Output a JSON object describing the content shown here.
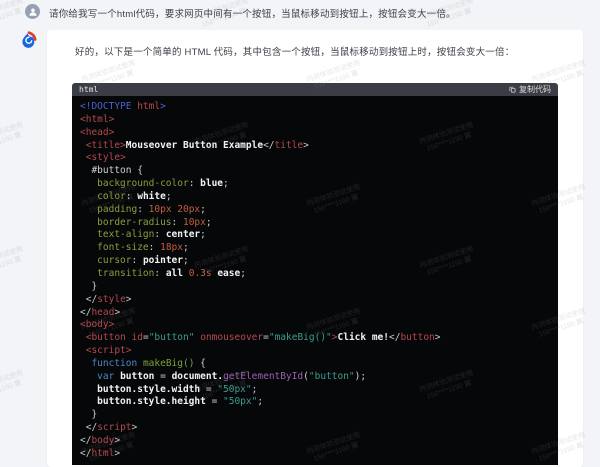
{
  "user_message": {
    "text": "请你给我写一个html代码，要求网页中间有一个按钮，当鼠标移动到按钮上，按钮会变大一倍。"
  },
  "assistant": {
    "intro": "好的，以下是一个简单的 HTML 代码，其中包含一个按钮，当鼠标移动到按钮上时，按钮会变大一倍："
  },
  "watermark": {
    "line1": "内测体验测试使用",
    "line2": "156****1190 翼"
  },
  "icons": {
    "user_avatar": "person-icon",
    "assistant_avatar": "spark-flame-icon",
    "copy": "copy-icon"
  },
  "colors": {
    "page_bg": "#f2f4f7",
    "card_bg": "#ffffff",
    "avatar_blue": "#1a66dd",
    "avatar_red": "#e03a2c"
  },
  "code_block": {
    "language_label": "html",
    "copy_label": "复制代码",
    "header_bg": "#3a3d45",
    "body_bg": "#060709",
    "token_colors": {
      "meta": "#4a63cf",
      "tag": "#b5494e",
      "pun": "#c9c9c9",
      "str": "#3d9c8f",
      "prop": "#86a03c",
      "num": "#c15f3c",
      "kw": "#4f86c6",
      "fn": "#79a43c",
      "mth": "#9a5fb5",
      "txt": "#f2f2f2",
      "pln": "#cfcfcf"
    },
    "lines": [
      [
        {
          "c": "meta",
          "t": "<!DOCTYPE "
        },
        {
          "c": "tag",
          "t": "html"
        },
        {
          "c": "meta",
          "t": ">"
        }
      ],
      [
        {
          "c": "tag",
          "t": "<html>"
        }
      ],
      [
        {
          "c": "tag",
          "t": "<head>"
        }
      ],
      [
        {
          "c": "pln",
          "t": " "
        },
        {
          "c": "tag",
          "t": "<title>"
        },
        {
          "c": "txt",
          "t": "Mouseover Button Example"
        },
        {
          "c": "pun",
          "t": "</"
        },
        {
          "c": "tag",
          "t": "title"
        },
        {
          "c": "pun",
          "t": ">"
        }
      ],
      [
        {
          "c": "pln",
          "t": " "
        },
        {
          "c": "tag",
          "t": "<style>"
        }
      ],
      [
        {
          "c": "pln",
          "t": "  #button {"
        }
      ],
      [
        {
          "c": "pln",
          "t": "   "
        },
        {
          "c": "prop",
          "t": "background-color"
        },
        {
          "c": "pun",
          "t": ": "
        },
        {
          "c": "txt",
          "t": "blue"
        },
        {
          "c": "pun",
          "t": ";"
        }
      ],
      [
        {
          "c": "pln",
          "t": "   "
        },
        {
          "c": "prop",
          "t": "color"
        },
        {
          "c": "pun",
          "t": ": "
        },
        {
          "c": "txt",
          "t": "white"
        },
        {
          "c": "pun",
          "t": ";"
        }
      ],
      [
        {
          "c": "pln",
          "t": "   "
        },
        {
          "c": "prop",
          "t": "padding"
        },
        {
          "c": "pun",
          "t": ": "
        },
        {
          "c": "num",
          "t": "10px 20px"
        },
        {
          "c": "pun",
          "t": ";"
        }
      ],
      [
        {
          "c": "pln",
          "t": "   "
        },
        {
          "c": "prop",
          "t": "border-radius"
        },
        {
          "c": "pun",
          "t": ": "
        },
        {
          "c": "num",
          "t": "10px"
        },
        {
          "c": "pun",
          "t": ";"
        }
      ],
      [
        {
          "c": "pln",
          "t": "   "
        },
        {
          "c": "prop",
          "t": "text-align"
        },
        {
          "c": "pun",
          "t": ": "
        },
        {
          "c": "txt",
          "t": "center"
        },
        {
          "c": "pun",
          "t": ";"
        }
      ],
      [
        {
          "c": "pln",
          "t": "   "
        },
        {
          "c": "prop",
          "t": "font-size"
        },
        {
          "c": "pun",
          "t": ": "
        },
        {
          "c": "num",
          "t": "18px"
        },
        {
          "c": "pun",
          "t": ";"
        }
      ],
      [
        {
          "c": "pln",
          "t": "   "
        },
        {
          "c": "prop",
          "t": "cursor"
        },
        {
          "c": "pun",
          "t": ": "
        },
        {
          "c": "txt",
          "t": "pointer"
        },
        {
          "c": "pun",
          "t": ";"
        }
      ],
      [
        {
          "c": "pln",
          "t": "   "
        },
        {
          "c": "prop",
          "t": "transition"
        },
        {
          "c": "pun",
          "t": ": "
        },
        {
          "c": "txt",
          "t": "all "
        },
        {
          "c": "num",
          "t": "0.3s"
        },
        {
          "c": "txt",
          "t": " ease"
        },
        {
          "c": "pun",
          "t": ";"
        }
      ],
      [
        {
          "c": "pln",
          "t": "  }"
        }
      ],
      [
        {
          "c": "pln",
          "t": " "
        },
        {
          "c": "pun",
          "t": "</"
        },
        {
          "c": "tag",
          "t": "style"
        },
        {
          "c": "pun",
          "t": ">"
        }
      ],
      [
        {
          "c": "pun",
          "t": "</"
        },
        {
          "c": "tag",
          "t": "head"
        },
        {
          "c": "pun",
          "t": ">"
        }
      ],
      [
        {
          "c": "tag",
          "t": "<body>"
        }
      ],
      [
        {
          "c": "pln",
          "t": " "
        },
        {
          "c": "tag",
          "t": "<button "
        },
        {
          "c": "tag",
          "t": "id"
        },
        {
          "c": "pun",
          "t": "="
        },
        {
          "c": "str",
          "t": "\"button\""
        },
        {
          "c": "pln",
          "t": " "
        },
        {
          "c": "tag",
          "t": "onmouseover"
        },
        {
          "c": "pun",
          "t": "="
        },
        {
          "c": "str",
          "t": "\"makeBig()\""
        },
        {
          "c": "tag",
          "t": ">"
        },
        {
          "c": "txt",
          "t": "Click me!"
        },
        {
          "c": "pun",
          "t": "</"
        },
        {
          "c": "tag",
          "t": "button"
        },
        {
          "c": "pun",
          "t": ">"
        }
      ],
      [
        {
          "c": "pln",
          "t": " "
        },
        {
          "c": "tag",
          "t": "<script>"
        }
      ],
      [
        {
          "c": "pln",
          "t": "  "
        },
        {
          "c": "kw",
          "t": "function"
        },
        {
          "c": "pln",
          "t": " "
        },
        {
          "c": "fn",
          "t": "makeBig()"
        },
        {
          "c": "pln",
          "t": " {"
        }
      ],
      [
        {
          "c": "pln",
          "t": "   "
        },
        {
          "c": "kw",
          "t": "var"
        },
        {
          "c": "pln",
          "t": " "
        },
        {
          "c": "txt",
          "t": "button"
        },
        {
          "c": "pln",
          "t": " = "
        },
        {
          "c": "txt",
          "t": "document."
        },
        {
          "c": "mth",
          "t": "getElementById"
        },
        {
          "c": "pln",
          "t": "("
        },
        {
          "c": "str",
          "t": "\"button\""
        },
        {
          "c": "pln",
          "t": ");"
        }
      ],
      [
        {
          "c": "pln",
          "t": "   "
        },
        {
          "c": "txt",
          "t": "button.style.width"
        },
        {
          "c": "pln",
          "t": " = "
        },
        {
          "c": "str",
          "t": "\"50px\""
        },
        {
          "c": "pun",
          "t": ";"
        }
      ],
      [
        {
          "c": "pln",
          "t": "   "
        },
        {
          "c": "txt",
          "t": "button.style.height"
        },
        {
          "c": "pln",
          "t": " = "
        },
        {
          "c": "str",
          "t": "\"50px\""
        },
        {
          "c": "pun",
          "t": ";"
        }
      ],
      [
        {
          "c": "pln",
          "t": "  }"
        }
      ],
      [
        {
          "c": "pln",
          "t": " "
        },
        {
          "c": "pun",
          "t": "</"
        },
        {
          "c": "tag",
          "t": "script"
        },
        {
          "c": "pun",
          "t": ">"
        }
      ],
      [
        {
          "c": "pun",
          "t": "</"
        },
        {
          "c": "tag",
          "t": "body"
        },
        {
          "c": "pun",
          "t": ">"
        }
      ],
      [
        {
          "c": "pun",
          "t": "</"
        },
        {
          "c": "tag",
          "t": "html"
        },
        {
          "c": "pun",
          "t": ">"
        }
      ]
    ]
  }
}
